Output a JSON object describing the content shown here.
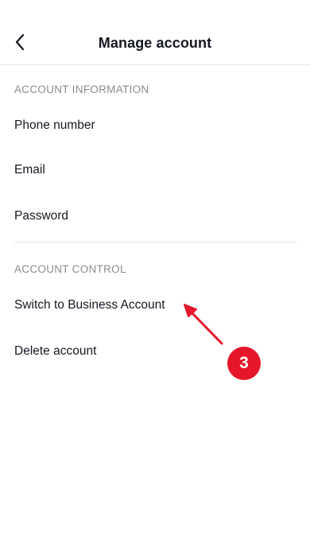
{
  "header": {
    "title": "Manage account",
    "back_icon": "chevron-left-icon"
  },
  "sections": {
    "account_information": {
      "title": "ACCOUNT INFORMATION",
      "items": [
        {
          "label": "Phone number"
        },
        {
          "label": "Email"
        },
        {
          "label": "Password"
        }
      ]
    },
    "account_control": {
      "title": "ACCOUNT CONTROL",
      "items": [
        {
          "label": "Switch to Business Account"
        },
        {
          "label": "Delete account"
        }
      ]
    }
  },
  "annotation": {
    "step_number": "3",
    "color": "#e5162a"
  }
}
